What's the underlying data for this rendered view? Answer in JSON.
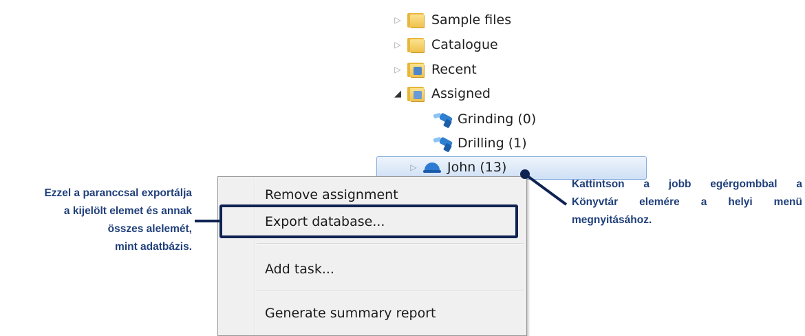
{
  "tree": {
    "items": [
      {
        "label": "Sample files",
        "icon": "folder-icon"
      },
      {
        "label": "Catalogue",
        "icon": "folder-icon"
      },
      {
        "label": "Recent",
        "icon": "recent-folder-icon"
      },
      {
        "label": "Assigned",
        "icon": "assigned-folder-icon"
      },
      {
        "label": "Grinding (0)",
        "icon": "grinding-tool-icon"
      },
      {
        "label": "Drilling (1)",
        "icon": "drilling-tool-icon"
      },
      {
        "label": "John (13)",
        "icon": "worker-helmet-icon"
      }
    ]
  },
  "context_menu": {
    "items": [
      {
        "label": "Remove assignment"
      },
      {
        "label": "Export database..."
      },
      {
        "label": "Add task..."
      },
      {
        "label": "Generate summary report"
      }
    ]
  },
  "annotations": {
    "left_lines": [
      "Ezzel a paranccsal exportálja",
      "a kijelölt elemet és annak",
      "összes alelemét,",
      "mint adatbázis."
    ],
    "right_lines": [
      "Kattintson a jobb egérgombbal a",
      "Könyvtár elemére a helyi menü",
      "megnyitásához."
    ]
  },
  "colors": {
    "annotation_text": "#1f3f7a",
    "highlight_border": "#0f2352",
    "selection_border": "#84acdd",
    "folder": "#e7b73b",
    "tool_blue": "#2f7fd0"
  }
}
